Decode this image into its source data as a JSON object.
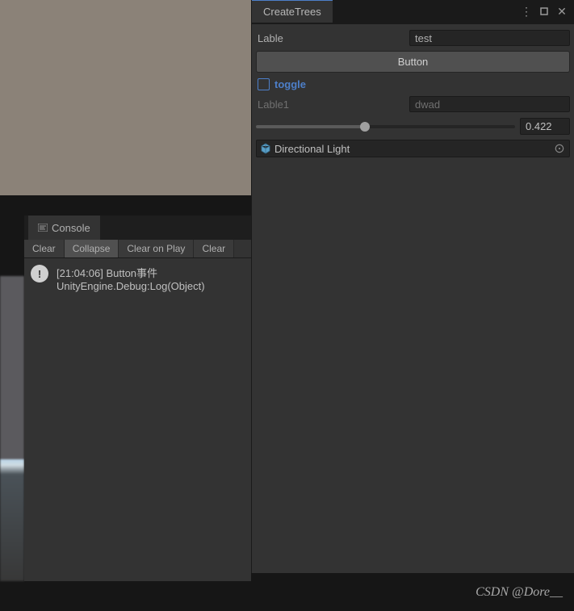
{
  "viewport": {
    "bg": "#8b8278"
  },
  "console": {
    "tab_label": "Console",
    "toolbar": {
      "clear": "Clear",
      "collapse": "Collapse",
      "clear_on_play": "Clear on Play",
      "clear_partial": "Clear"
    },
    "log": {
      "timestamp": "[21:04:06]",
      "message": "Button事件",
      "trace": "UnityEngine.Debug:Log(Object)"
    }
  },
  "inspector": {
    "tab_label": "CreateTrees",
    "fields": {
      "lable": {
        "label": "Lable",
        "value": "test"
      },
      "button_label": "Button",
      "toggle_label": "toggle",
      "lable1": {
        "label": "Lable1",
        "value": "dwad"
      },
      "slider": {
        "value": 0.422,
        "display": "0.422"
      },
      "object": {
        "name": "Directional Light"
      }
    }
  },
  "watermark": "CSDN @Dore__"
}
